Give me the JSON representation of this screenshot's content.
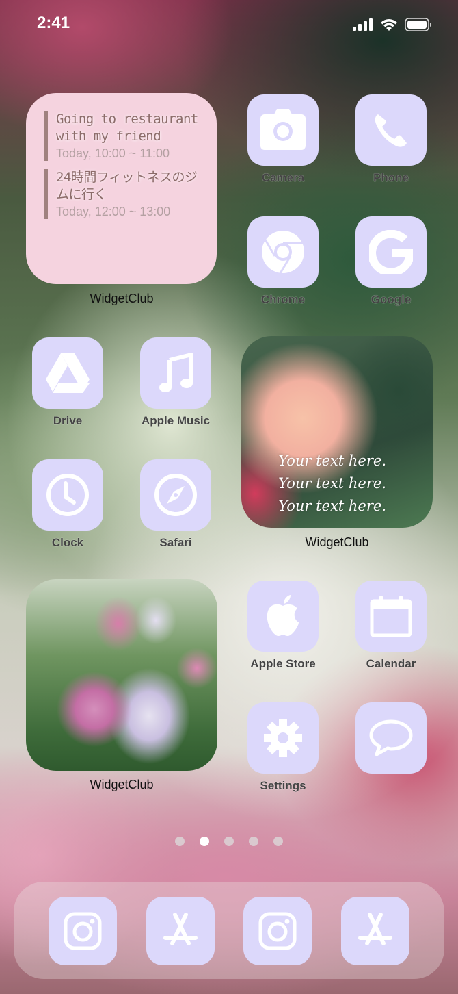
{
  "status_bar": {
    "time": "2:41",
    "icons": [
      "signal-icon",
      "wifi-icon",
      "battery-icon"
    ]
  },
  "calendar_widget": {
    "label": "WidgetClub",
    "events": [
      {
        "title": "Going to restaurant with my friend",
        "time": "Today, 10:00 ~ 11:00"
      },
      {
        "title": "24時間フィットネスのジムに行く",
        "time": "Today, 12:00 ~ 13:00"
      }
    ]
  },
  "photo_widget_1": {
    "label": "WidgetClub",
    "lines": [
      "Your text here.",
      "Your text here.",
      "Your text here."
    ]
  },
  "photo_widget_2": {
    "label": "WidgetClub"
  },
  "apps": {
    "camera": "Camera",
    "phone": "Phone",
    "chrome": "Chrome",
    "google": "Google",
    "drive": "Drive",
    "apple_music": "Apple Music",
    "clock": "Clock",
    "safari": "Safari",
    "apple_store": "Apple Store",
    "calendar": "Calendar",
    "settings": "Settings",
    "messages": ""
  },
  "page_indicator": {
    "total": 5,
    "current": 2
  },
  "dock": [
    "instagram-icon",
    "app-store-icon",
    "instagram-icon",
    "app-store-icon"
  ],
  "colors": {
    "icon_bg": "#dcd8fb",
    "widget_bg": "#f5d3df",
    "event_bar": "#a0817f"
  }
}
